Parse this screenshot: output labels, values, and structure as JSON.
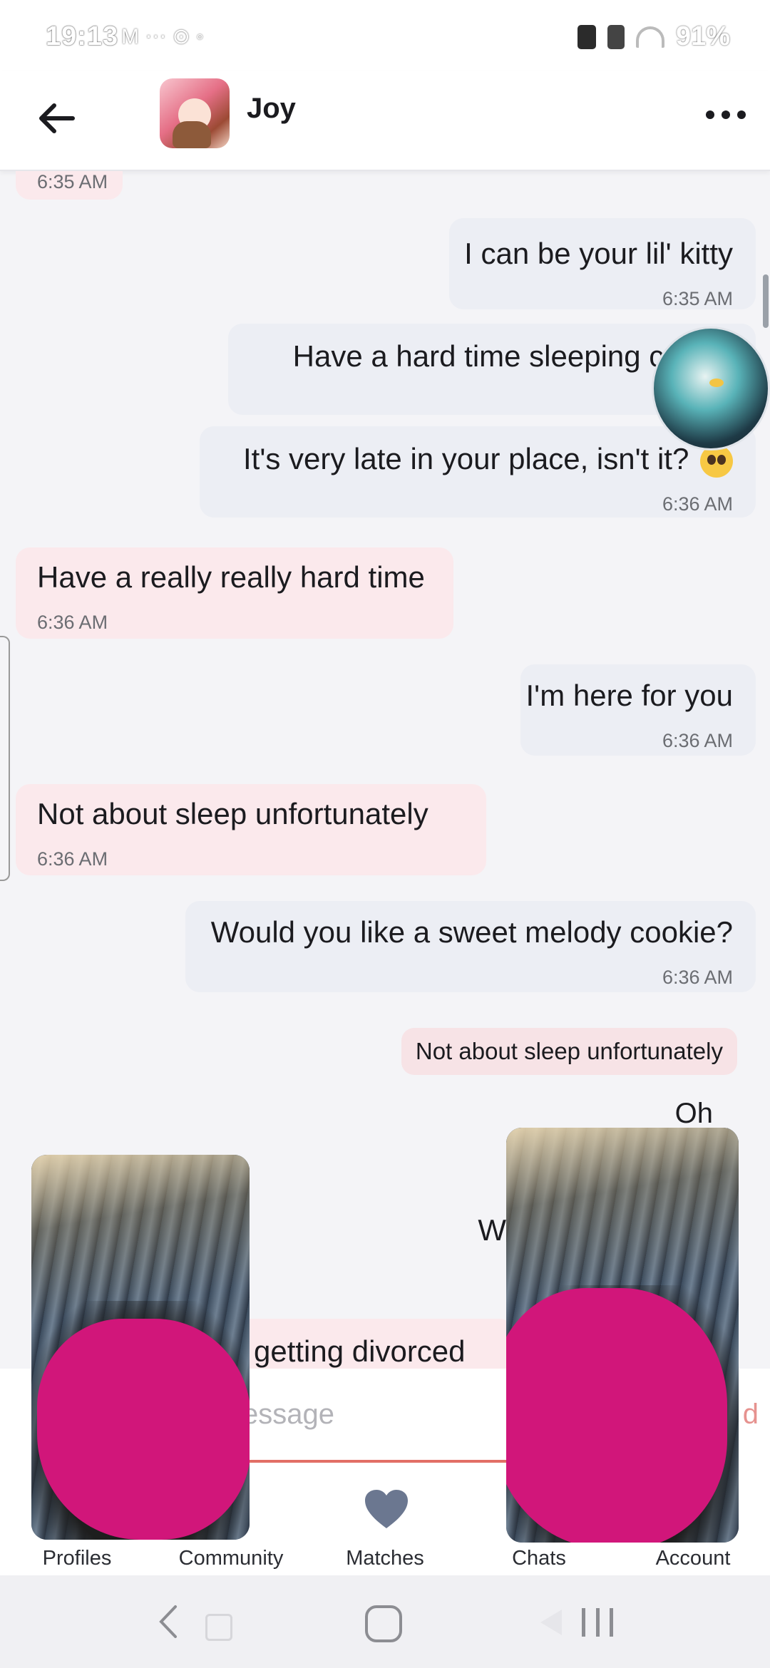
{
  "status_bar": {
    "time": "19:13",
    "left_icons": "M ⋯ ⊙ ◦",
    "battery": "91%"
  },
  "header": {
    "contact_name": "Joy"
  },
  "messages": [
    {
      "side": "in",
      "text": "",
      "time": "6:35 AM"
    },
    {
      "side": "out",
      "text": "I can be your lil' kitty",
      "time": "6:35 AM"
    },
    {
      "side": "out",
      "text": "Have a hard time sleeping coo",
      "time": ""
    },
    {
      "side": "out",
      "text": "It's very late in your place, isn't it?",
      "time": "6:36 AM",
      "emoji": "pleading-face"
    },
    {
      "side": "in",
      "text": "Have a really really hard time",
      "time": "6:36 AM"
    },
    {
      "side": "out",
      "text": "I'm here for you",
      "time": "6:36 AM"
    },
    {
      "side": "in",
      "text": "Not about sleep unfortunately",
      "time": "6:36 AM"
    },
    {
      "side": "out",
      "text": "Would you like a sweet melody cookie?",
      "time": "6:36 AM"
    },
    {
      "side": "out",
      "quote": "Not about sleep unfortunately",
      "text": "Oh"
    },
    {
      "side": "out",
      "text": "W"
    },
    {
      "side": "in",
      "text": "getting divorced"
    }
  ],
  "input": {
    "placeholder": "essage",
    "send_label": "d"
  },
  "bottom_nav": [
    {
      "label": "Profiles",
      "icon": "profiles-icon"
    },
    {
      "label": "Community",
      "icon": "community-icon"
    },
    {
      "label": "Matches",
      "icon": "heart-icon"
    },
    {
      "label": "Chats",
      "icon": "chat-icon"
    },
    {
      "label": "Account",
      "icon": "account-icon"
    }
  ],
  "colors": {
    "incoming_bubble": "#fbe9ec",
    "outgoing_bubble": "#eceef4",
    "accent": "#e26f66",
    "heart": "#6b7790",
    "redaction": "#d1167a"
  }
}
